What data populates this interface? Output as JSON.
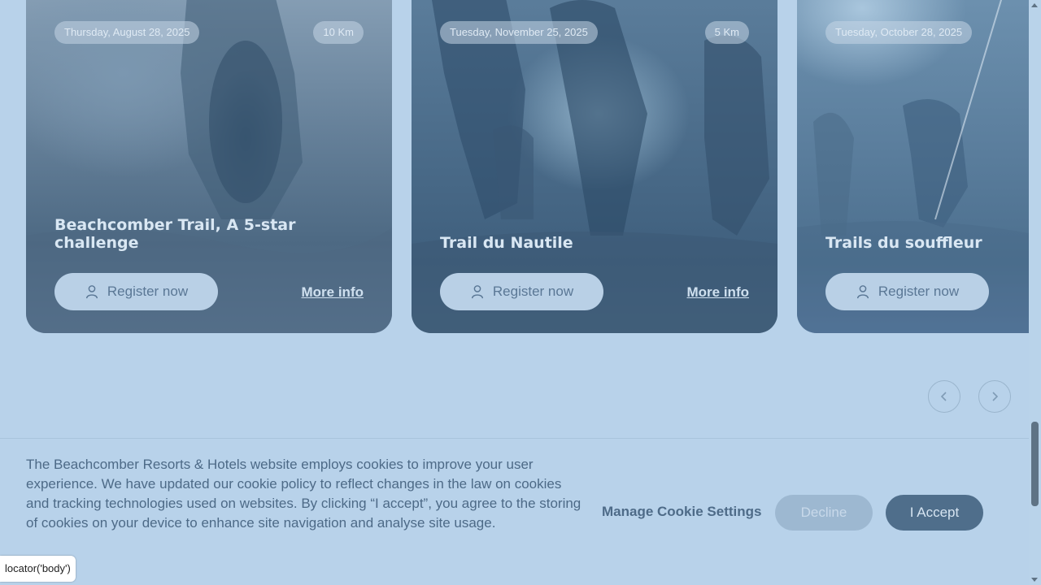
{
  "cards": [
    {
      "date": "Thursday, August 28, 2025",
      "distance": "10 Km",
      "title": "Beachcomber Trail, A 5-star challenge",
      "register_label": "Register now",
      "more_info_label": "More info"
    },
    {
      "date": "Tuesday, November 25, 2025",
      "distance": "5 Km",
      "title": "Trail du Nautile",
      "register_label": "Register now",
      "more_info_label": "More info"
    },
    {
      "date": "Tuesday, October 28, 2025",
      "distance": "",
      "title": "Trails du souffleur",
      "register_label": "Register now",
      "more_info_label": ""
    }
  ],
  "carousel": {
    "prev_icon": "chevron-left-icon",
    "next_icon": "chevron-right-icon"
  },
  "cookie_banner": {
    "text": "The Beachcomber Resorts & Hotels website employs cookies to improve your user experience. We have updated our cookie policy to reflect changes in the law on cookies and tracking technologies used on websites. By clicking “I accept”, you agree to the storing of cookies on your device to enhance site navigation and analyse site usage.",
    "manage_label": "Manage Cookie Settings",
    "decline_label": "Decline",
    "accept_label": "I Accept"
  },
  "locator_tooltip": "locator('body')",
  "colors": {
    "page_bg": "#b8d2ea",
    "accent_dark": "#4f6e8b",
    "decline_bg": "#9db8d1"
  }
}
